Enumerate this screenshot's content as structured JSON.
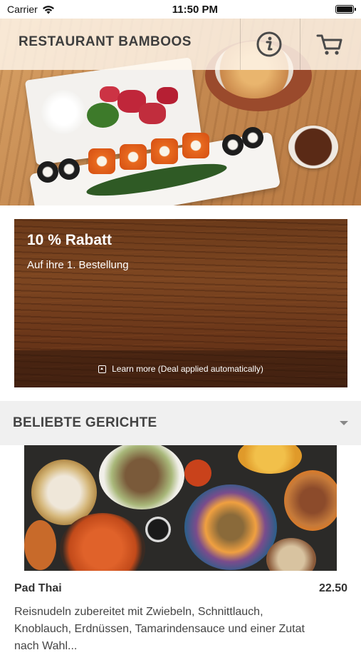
{
  "status_bar": {
    "carrier": "Carrier",
    "time": "11:50 PM"
  },
  "header": {
    "title": "RESTAURANT BAMBOOS",
    "info_icon": "info-icon",
    "cart_icon": "cart-icon"
  },
  "promo": {
    "title": "10 % Rabatt",
    "subtitle": "Auf ihre 1. Bestellung",
    "learn_more": "Learn more (Deal applied automatically)"
  },
  "section": {
    "title": "BELIEBTE GERICHTE"
  },
  "dish": {
    "name": "Pad Thai",
    "price": "22.50",
    "description": "Reisnudeln zubereitet mit Zwiebeln, Schnittlauch, Knoblauch, Erdnüssen, Tamarindensauce und einer Zutat nach Wahl..."
  },
  "colors": {
    "header_overlay": "#fff8ee",
    "title_text": "#3e3e3e",
    "section_bg": "#f0f0f0"
  }
}
